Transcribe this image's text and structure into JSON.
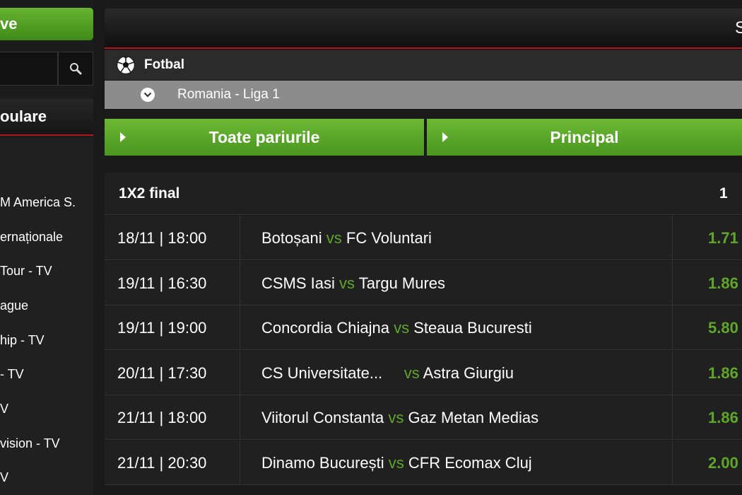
{
  "sidebar": {
    "live_label": "ve",
    "search_icon": "magnifier-icon",
    "popular_title": "oulare",
    "items": [
      "M America S.",
      "ernaționale",
      "Tour - TV",
      "ague",
      "hip - TV",
      " - TV",
      "V",
      "vision - TV",
      "V"
    ]
  },
  "header": {
    "letter": "S"
  },
  "sport": {
    "label": "Fotbal",
    "icon": "soccer-ball-icon"
  },
  "league": {
    "label": "Romania - Liga 1",
    "icon": "chevron-down-icon"
  },
  "tabs": {
    "all": "Toate pariurile",
    "main": "Principal"
  },
  "market": {
    "title": "1X2 final",
    "col1": "1"
  },
  "vs_label": "vs",
  "matches": [
    {
      "date": "18/11 | 18:00",
      "home": "Botoșani",
      "away": "FC Voluntari",
      "odd1": "1.71"
    },
    {
      "date": "19/11 | 16:30",
      "home": "CSMS Iasi",
      "away": "Targu Mures",
      "odd1": "1.86"
    },
    {
      "date": "19/11 | 19:00",
      "home": "Concordia Chiajna",
      "away": "Steaua Bucuresti",
      "odd1": "5.80"
    },
    {
      "date": "20/11 | 17:30",
      "home": "CS Universitate...",
      "away": "Astra Giurgiu",
      "odd1": "1.86"
    },
    {
      "date": "21/11 | 18:00",
      "home": "Viitorul Constanta",
      "away": "Gaz Metan Medias",
      "odd1": "1.86"
    },
    {
      "date": "21/11 | 20:30",
      "home": "Dinamo București",
      "away": "CFR Ecomax Cluj",
      "odd1": "2.00"
    }
  ],
  "colors": {
    "accent_green": "#5fa62b",
    "tab_green": "#6cb834",
    "divider_red": "#b3151d"
  }
}
